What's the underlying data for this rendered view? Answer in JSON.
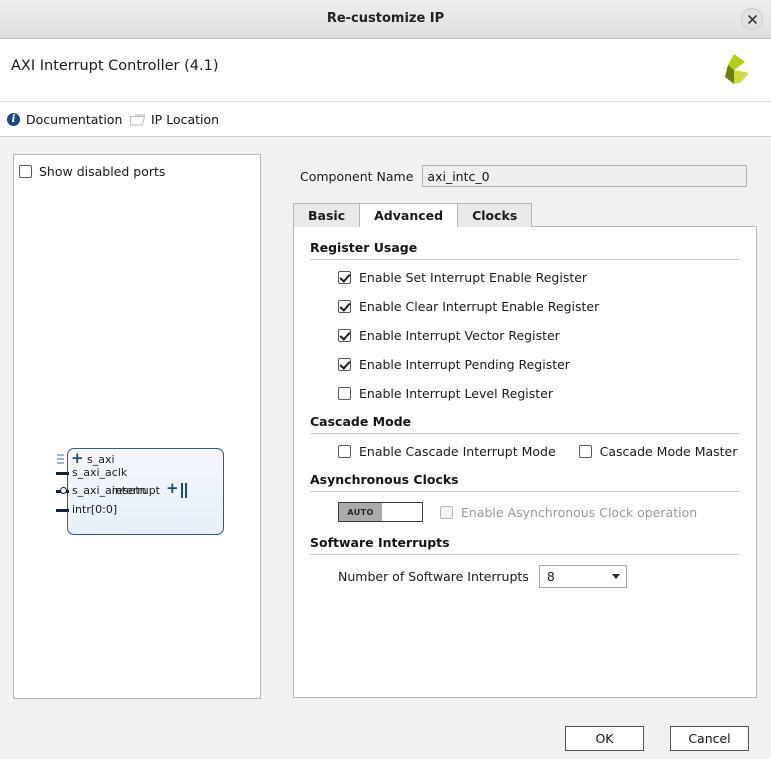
{
  "window": {
    "title": "Re-customize IP",
    "close_icon": "close-icon"
  },
  "header": {
    "ip_title": "AXI Interrupt Controller (4.1)",
    "logo_icon": "xilinx-logo-icon"
  },
  "toolbar": {
    "documentation_label": "Documentation",
    "documentation_icon": "info-icon",
    "ip_location_label": "IP Location",
    "ip_location_icon": "folder-icon"
  },
  "diagram": {
    "show_disabled_ports_label": "Show disabled ports",
    "show_disabled_ports_checked": false,
    "symbol": {
      "inputs": [
        {
          "label": "s_axi",
          "kind": "bus"
        },
        {
          "label": "s_axi_aclk",
          "kind": "clock"
        },
        {
          "label": "s_axi_aresetn",
          "kind": "reset"
        },
        {
          "label": "intr[0:0]",
          "kind": "signal"
        }
      ],
      "outputs": [
        {
          "label": "interrupt",
          "kind": "bus"
        }
      ]
    }
  },
  "component": {
    "name_label": "Component Name",
    "name_value": "axi_intc_0"
  },
  "tabs": [
    {
      "label": "Basic",
      "active": false
    },
    {
      "label": "Advanced",
      "active": true
    },
    {
      "label": "Clocks",
      "active": false
    }
  ],
  "advanced": {
    "register_usage": {
      "title": "Register Usage",
      "options": [
        {
          "label": "Enable Set Interrupt Enable Register",
          "checked": true,
          "enabled": true
        },
        {
          "label": "Enable Clear Interrupt Enable Register",
          "checked": true,
          "enabled": true
        },
        {
          "label": "Enable Interrupt Vector Register",
          "checked": true,
          "enabled": true
        },
        {
          "label": "Enable Interrupt Pending Register",
          "checked": true,
          "enabled": true
        },
        {
          "label": "Enable Interrupt Level Register",
          "checked": false,
          "enabled": true
        }
      ]
    },
    "cascade_mode": {
      "title": "Cascade Mode",
      "options": [
        {
          "label": "Enable Cascade Interrupt Mode",
          "checked": false,
          "enabled": true
        },
        {
          "label": "Cascade Mode Master",
          "checked": false,
          "enabled": true
        }
      ]
    },
    "asynchronous_clocks": {
      "title": "Asynchronous Clocks",
      "toggle_value": "AUTO",
      "option": {
        "label": "Enable Asynchronous Clock operation",
        "checked": false,
        "enabled": false
      }
    },
    "software_interrupts": {
      "title": "Software Interrupts",
      "field_label": "Number of Software Interrupts",
      "field_value": "8"
    }
  },
  "footer": {
    "ok_label": "OK",
    "cancel_label": "Cancel"
  },
  "colors": {
    "accent_blue": "#1d4a86",
    "logo_green": "#a9c90f",
    "logo_dark": "#6f7d0b",
    "dialog_bg": "#f1f1f1"
  }
}
